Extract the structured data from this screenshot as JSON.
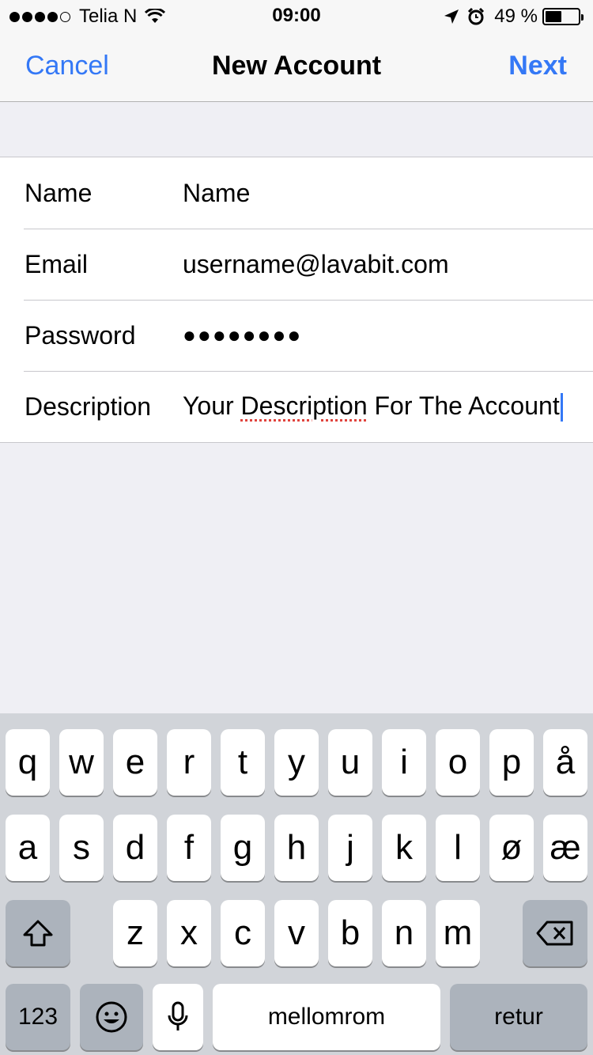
{
  "status_bar": {
    "carrier": "Telia N",
    "time": "09:00",
    "battery_percent": "49 %",
    "battery_level": 0.49
  },
  "nav": {
    "cancel_label": "Cancel",
    "title": "New Account",
    "next_label": "Next"
  },
  "form": {
    "rows": [
      {
        "label": "Name",
        "value": "Name"
      },
      {
        "label": "Email",
        "value": "username@lavabit.com"
      },
      {
        "label": "Password",
        "value": "●●●●●●●●"
      },
      {
        "label": "Description",
        "value_before": "Your ",
        "value_misspelled": "Description",
        "value_after": " For The Account"
      }
    ]
  },
  "keyboard": {
    "row1": [
      "q",
      "w",
      "e",
      "r",
      "t",
      "y",
      "u",
      "i",
      "o",
      "p",
      "å"
    ],
    "row2": [
      "a",
      "s",
      "d",
      "f",
      "g",
      "h",
      "j",
      "k",
      "l",
      "ø",
      "æ"
    ],
    "row3": [
      "z",
      "x",
      "c",
      "v",
      "b",
      "n",
      "m"
    ],
    "numbers_label": "123",
    "space_label": "mellomrom",
    "return_label": "retur"
  },
  "colors": {
    "accent": "#3478f6",
    "background": "#efeff4",
    "keyboard_bg": "#d1d4d9"
  }
}
